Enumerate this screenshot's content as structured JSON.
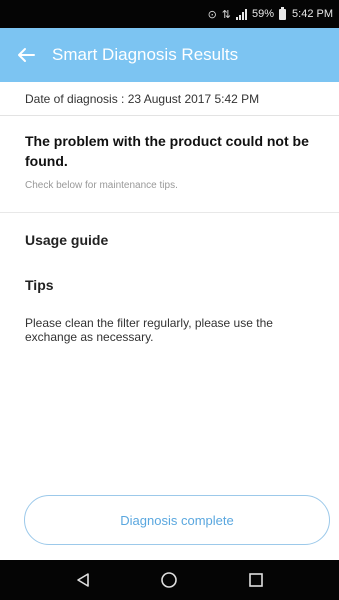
{
  "status_bar": {
    "battery_percent": "59%",
    "time": "5:42 PM"
  },
  "app_bar": {
    "back_icon": "arrow-left-icon",
    "title": "Smart Diagnosis Results"
  },
  "diagnosis": {
    "date_label": "Date of diagnosis : 23 August 2017 5:42 PM",
    "result_heading": "The problem with the product could not be found.",
    "result_sub": "Check below for maintenance tips."
  },
  "sections": {
    "usage_guide": "Usage guide",
    "tips_heading": "Tips",
    "tips_text": "Please clean the filter regularly, please use the exchange as necessary."
  },
  "action": {
    "button_label": "Diagnosis complete"
  },
  "nav_bar": {
    "icons": [
      "back-triangle-icon",
      "home-circle-icon",
      "recents-square-icon"
    ]
  },
  "colors": {
    "app_bar": "#7cc4f2",
    "button_border": "#9cc9ea",
    "button_text": "#5aa7df",
    "system_bars": "#050505"
  }
}
